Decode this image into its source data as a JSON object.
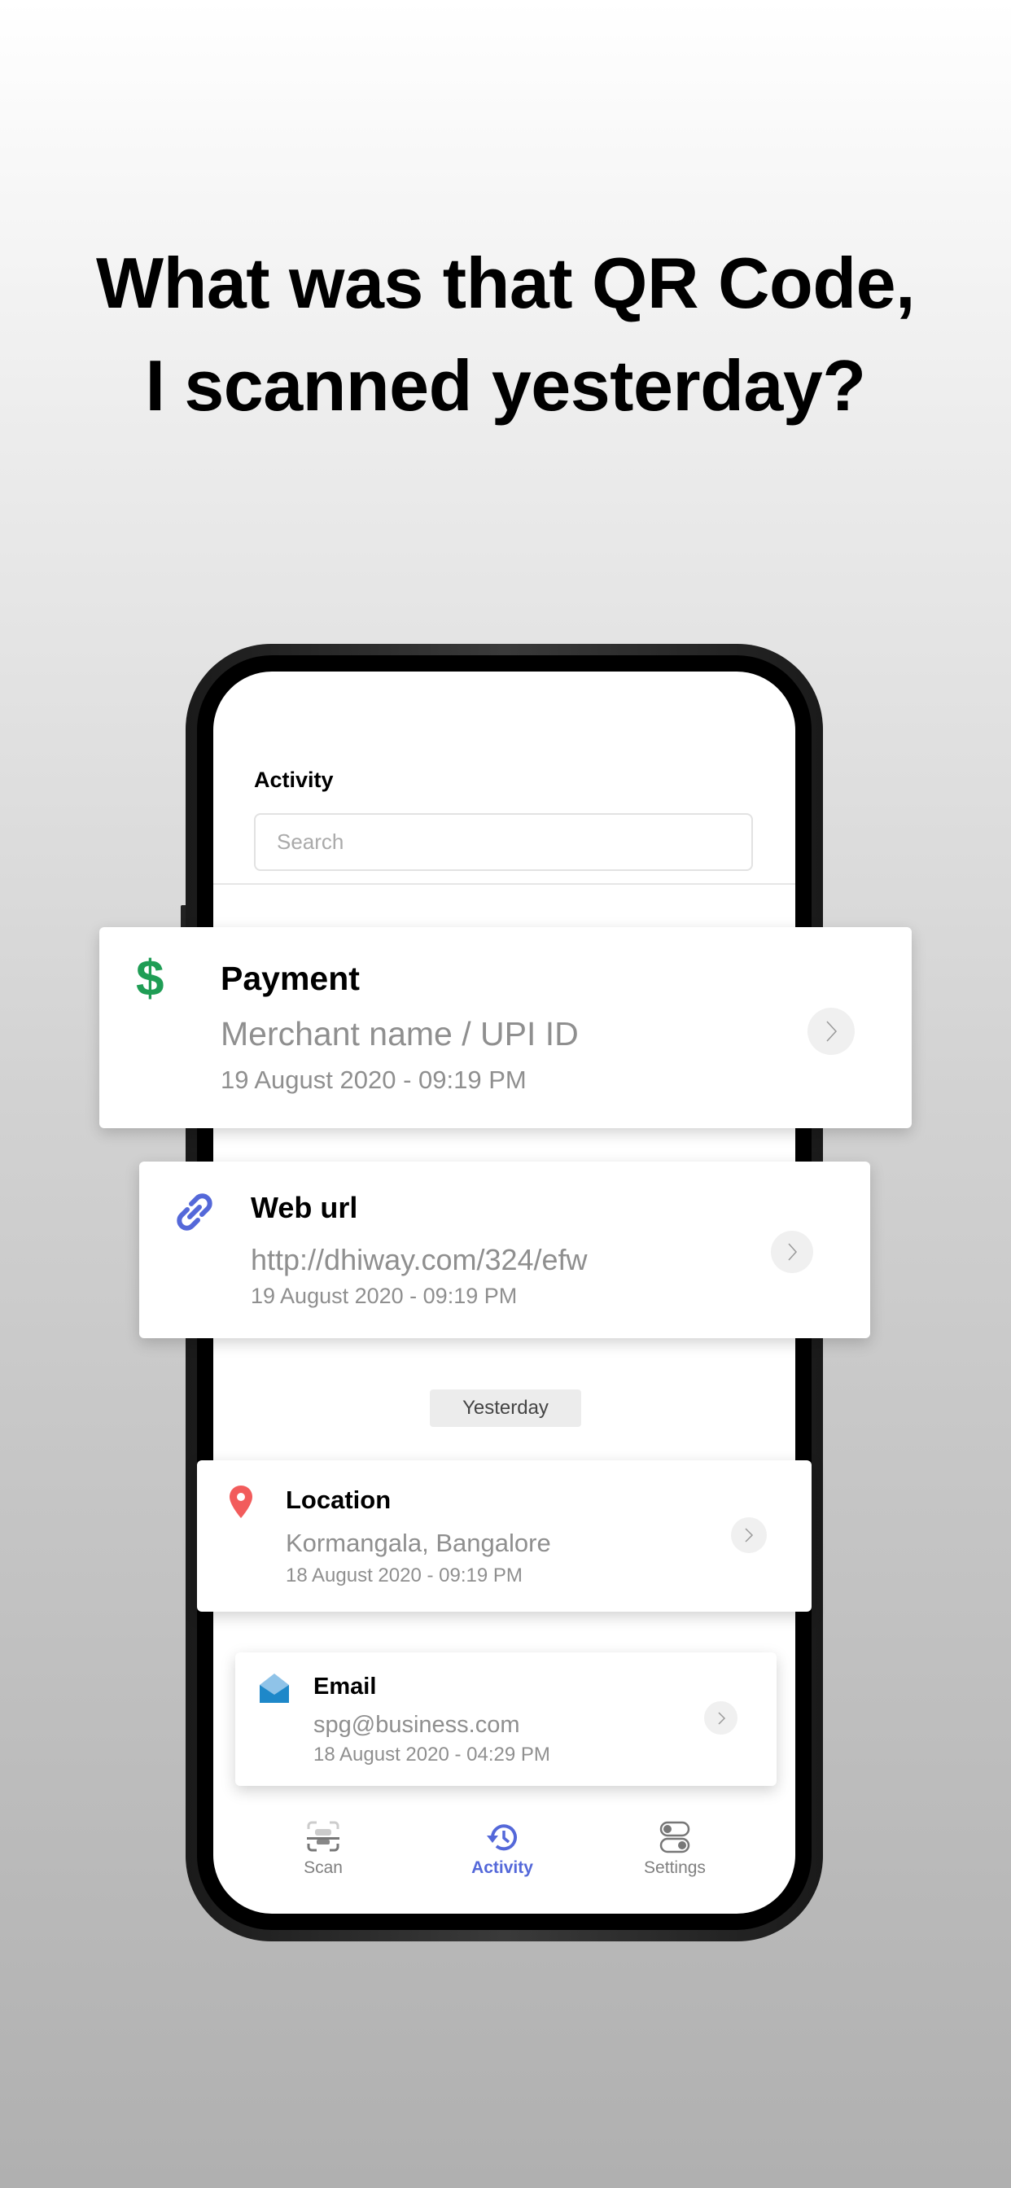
{
  "headline": {
    "line1": "What was that QR Code,",
    "line2": "I scanned yesterday?"
  },
  "screen": {
    "title": "Activity",
    "search_placeholder": "Search"
  },
  "items": [
    {
      "icon": "dollar-icon",
      "title": "Payment",
      "subtitle": "Merchant name / UPI ID",
      "date": "19 August 2020 - 09:19 PM",
      "color": "#1f9d55"
    },
    {
      "icon": "link-icon",
      "title": "Web url",
      "subtitle": "http://dhiway.com/324/efw",
      "date": "19 August 2020 - 09:19 PM",
      "color": "#5468d9"
    },
    {
      "icon": "location-pin-icon",
      "title": "Location",
      "subtitle": "Kormangala, Bangalore",
      "date": "18 August 2020 - 09:19 PM",
      "color": "#f25c5c"
    },
    {
      "icon": "email-icon",
      "title": "Email",
      "subtitle": "spg@business.com",
      "date": "18 August 2020 - 04:29 PM",
      "color": "#1e88c9"
    }
  ],
  "section_label": "Yesterday",
  "nav": [
    {
      "label": "Scan",
      "icon": "scan-icon"
    },
    {
      "label": "Activity",
      "icon": "history-icon",
      "active": true
    },
    {
      "label": "Settings",
      "icon": "toggle-settings-icon"
    }
  ],
  "colors": {
    "accent": "#5468d9"
  }
}
